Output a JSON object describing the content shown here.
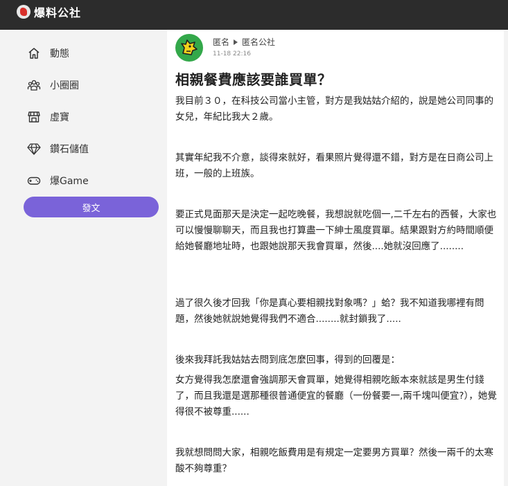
{
  "header": {
    "site_name": "爆料公社"
  },
  "sidebar": {
    "items": [
      {
        "label": "動態",
        "icon": "home-icon"
      },
      {
        "label": "小圈圈",
        "icon": "group-icon"
      },
      {
        "label": "虛寶",
        "icon": "shop-icon"
      },
      {
        "label": "鑽石儲值",
        "icon": "diamond-icon"
      },
      {
        "label": "爆Game",
        "icon": "gamepad-icon"
      }
    ],
    "post_button": "發文"
  },
  "post": {
    "author": "匿名",
    "group": "匿名公社",
    "timestamp": "11-18 22:16",
    "title": "相親餐費應該要誰買單？",
    "paragraphs": [
      "我目前３０，在科技公司當小主管，對方是我姑姑介紹的，說是她公司同事的女兒，年紀比我大２歲。",
      "其實年紀我不介意，談得來就好，看果照片覺得還不錯，對方是在日商公司上班，一般的上班族。",
      "要正式見面那天是決定一起吃晚餐，我想說就吃個一,二千左右的西餐，大家也可以慢慢聊聊天，而且我也打算盡一下紳士風度買單。結果跟對方約時間順便給她餐廳地址時，也跟她說那天我會買單，然後....她就沒回應了........",
      "過了很久後才回我「你是真心要相親找對象嗎？」蛤？我不知道我哪裡有問題，然後她就說她覺得我們不適合........就封鎖我了.....",
      "後來我拜託我姑姑去問到底怎麼回事，得到的回覆是：",
      "女方覺得我怎麼還會強調那天會買單，她覺得相親吃飯本來就該是男生付錢了，而且我還是選那種很普通便宜的餐廳（一份餐要一,兩千塊叫便宜?），她覺得很不被尊重......",
      "我就想問問大家，相親吃飯費用是有規定一定要男方買單？然後一兩千的太寒酸不夠尊重？"
    ]
  },
  "colors": {
    "topbar": "#2c2c2c",
    "accent": "#7a63d9",
    "avatar_bg": "#33a84a"
  }
}
